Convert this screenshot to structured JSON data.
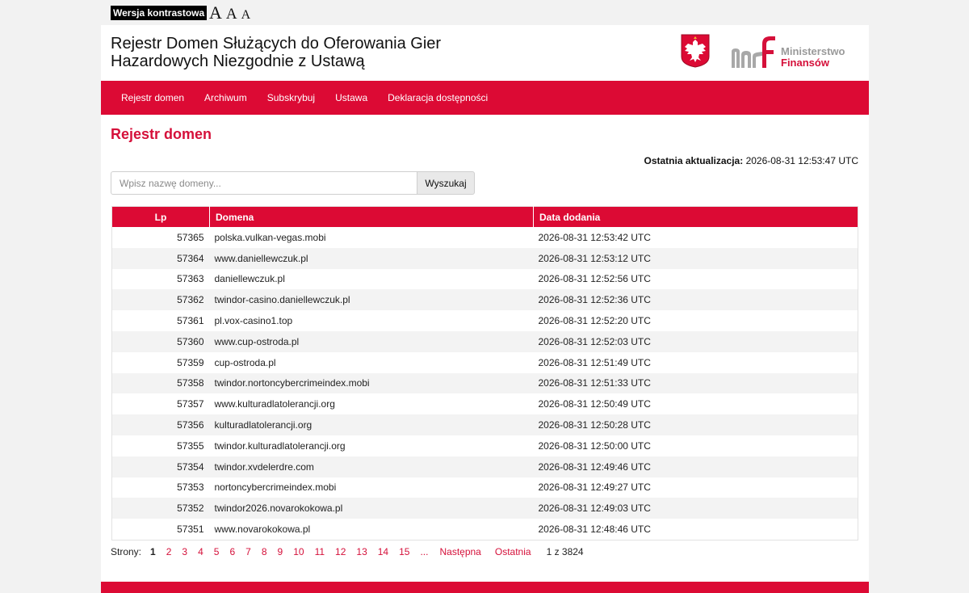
{
  "topbar": {
    "contrast_label": "Wersja kontrastowa",
    "font_large": "A",
    "font_medium": "A",
    "font_small": "A"
  },
  "header": {
    "title_line1": "Rejestr Domen Służących do Oferowania Gier",
    "title_line2": "Hazardowych Niezgodnie z Ustawą",
    "ministry_line1": "Ministerstwo",
    "ministry_line2": "Finansów"
  },
  "nav": {
    "items": [
      {
        "label": "Rejestr domen"
      },
      {
        "label": "Archiwum"
      },
      {
        "label": "Subskrybuj"
      },
      {
        "label": "Ustawa"
      },
      {
        "label": "Deklaracja dostępności"
      }
    ]
  },
  "main": {
    "heading": "Rejestr domen",
    "last_update_label": "Ostatnia aktualizacja:",
    "last_update_value": "2026-08-31 12:53:47 UTC"
  },
  "search": {
    "placeholder": "Wpisz nazwę domeny...",
    "button_label": "Wyszukaj"
  },
  "table": {
    "columns": [
      "Lp",
      "Domena",
      "Data dodania"
    ],
    "rows": [
      [
        "57365",
        "polska.vulkan-vegas.mobi",
        "2026-08-31 12:53:42 UTC"
      ],
      [
        "57364",
        "www.daniellewczuk.pl",
        "2026-08-31 12:53:12 UTC"
      ],
      [
        "57363",
        "daniellewczuk.pl",
        "2026-08-31 12:52:56 UTC"
      ],
      [
        "57362",
        "twindor-casino.daniellewczuk.pl",
        "2026-08-31 12:52:36 UTC"
      ],
      [
        "57361",
        "pl.vox-casino1.top",
        "2026-08-31 12:52:20 UTC"
      ],
      [
        "57360",
        "www.cup-ostroda.pl",
        "2026-08-31 12:52:03 UTC"
      ],
      [
        "57359",
        "cup-ostroda.pl",
        "2026-08-31 12:51:49 UTC"
      ],
      [
        "57358",
        "twindor.nortoncybercrimeindex.mobi",
        "2026-08-31 12:51:33 UTC"
      ],
      [
        "57357",
        "www.kulturadlatolerancji.org",
        "2026-08-31 12:50:49 UTC"
      ],
      [
        "57356",
        "kulturadlatolerancji.org",
        "2026-08-31 12:50:28 UTC"
      ],
      [
        "57355",
        "twindor.kulturadlatolerancji.org",
        "2026-08-31 12:50:00 UTC"
      ],
      [
        "57354",
        "twindor.xvdelerdre.com",
        "2026-08-31 12:49:46 UTC"
      ],
      [
        "57353",
        "nortoncybercrimeindex.mobi",
        "2026-08-31 12:49:27 UTC"
      ],
      [
        "57352",
        "twindor2026.novarokokowa.pl",
        "2026-08-31 12:49:03 UTC"
      ],
      [
        "57351",
        "www.novarokokowa.pl",
        "2026-08-31 12:48:46 UTC"
      ]
    ]
  },
  "pager": {
    "label": "Strony:",
    "current": "1",
    "pages": [
      "2",
      "3",
      "4",
      "5",
      "6",
      "7",
      "8",
      "9",
      "10",
      "11",
      "12",
      "13",
      "14",
      "15"
    ],
    "ellipsis": "...",
    "next_label": "Następna",
    "last_label": "Ostatnia",
    "count": "1 z 3824"
  },
  "colors": {
    "brand_red": "#dc0a34",
    "heading_red": "#d5103a",
    "ministry_grey": "#9a9a9a"
  },
  "icons": {
    "emblem": "polish-eagle-emblem-icon",
    "ministry_logo": "ministry-of-finance-logo-icon"
  }
}
